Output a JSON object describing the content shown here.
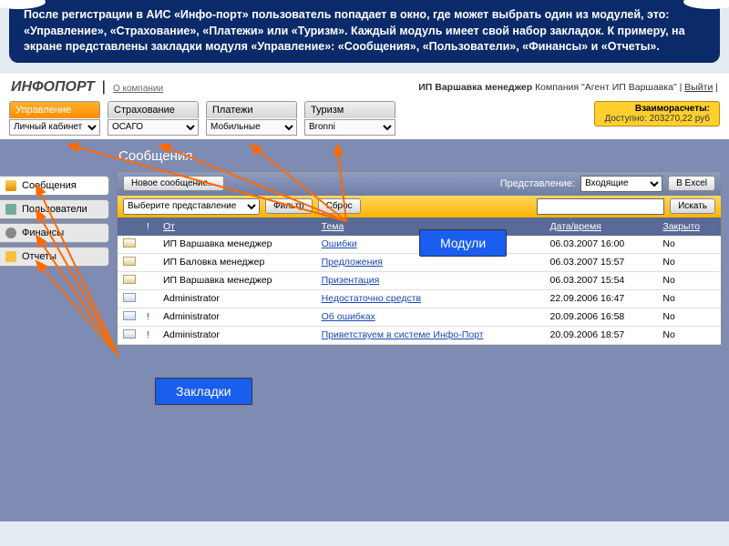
{
  "description": "После регистрации в АИС «Инфо-порт» пользователь попадает в окно, где может выбрать один из модулей, это: «Управление», «Страхование», «Платежи» или «Туризм». Каждый модуль имеет свой набор закладок. К примеру, на экране представлены закладки модуля «Управление»: «Сообщения», «Пользователи», «Финансы» и «Отчеты».",
  "header": {
    "logo": "ИНФОПОРТ",
    "about": "О компании",
    "user_name": "ИП Варшавка менеджер",
    "company_label": "Компания",
    "company_name": "\"Агент ИП Варшавка\"",
    "logout": "Выйти"
  },
  "balance": {
    "title": "Взаиморасчеты:",
    "line": "Доступно: 203270,22 руб"
  },
  "modules": [
    {
      "label": "Управление",
      "option": "Личный кабинет",
      "active": true
    },
    {
      "label": "Страхование",
      "option": "ОСАГО",
      "active": false
    },
    {
      "label": "Платежи",
      "option": "Мобильные",
      "active": false
    },
    {
      "label": "Туризм",
      "option": "Bronni",
      "active": false
    }
  ],
  "sidebar": {
    "items": [
      {
        "label": "Сообщения",
        "icon": "ic-msg",
        "sel": true
      },
      {
        "label": "Пользователи",
        "icon": "ic-users",
        "sel": false
      },
      {
        "label": "Финансы",
        "icon": "ic-fin",
        "sel": false
      },
      {
        "label": "Отчеты",
        "icon": "ic-rep",
        "sel": false
      }
    ]
  },
  "section_title": "Сообщения",
  "toolbar": {
    "new_msg": "Новое сообщение...",
    "view_label": "Представление:",
    "view_value": "Входящие",
    "excel": "В Excel"
  },
  "filter": {
    "select_value": "Выберите представление",
    "filter_btn": "Фильтр",
    "reset_btn": "Сброс",
    "search_btn": "Искать"
  },
  "table": {
    "cols": {
      "from": "От",
      "subject": "Тема",
      "datetime": "Дата/время",
      "closed": "Закрыто"
    },
    "rows": [
      {
        "env": "closed",
        "flag": false,
        "from": "ИП Варшавка менеджер",
        "subject": "Ошибки",
        "datetime": "06.03.2007 16:00",
        "closed": "No"
      },
      {
        "env": "closed",
        "flag": false,
        "from": "ИП Баловка менеджер",
        "subject": "Предложения",
        "datetime": "06.03.2007 15:57",
        "closed": "No"
      },
      {
        "env": "closed",
        "flag": false,
        "from": "ИП Варшавка менеджер",
        "subject": "Призентация",
        "datetime": "06.03.2007 15:54",
        "closed": "No"
      },
      {
        "env": "open",
        "flag": false,
        "from": "Administrator",
        "subject": "Недостаточно средств",
        "datetime": "22.09.2006 16:47",
        "closed": "No"
      },
      {
        "env": "open",
        "flag": true,
        "from": "Administrator",
        "subject": "Об ошибках",
        "datetime": "20.09.2006 16:58",
        "closed": "No"
      },
      {
        "env": "open",
        "flag": true,
        "from": "Administrator",
        "subject": "Приветствуем в системе Инфо-Порт",
        "datetime": "20.09.2006 18:57",
        "closed": "No"
      }
    ]
  },
  "callouts": {
    "modules": "Модули",
    "tabs": "Закладки"
  }
}
